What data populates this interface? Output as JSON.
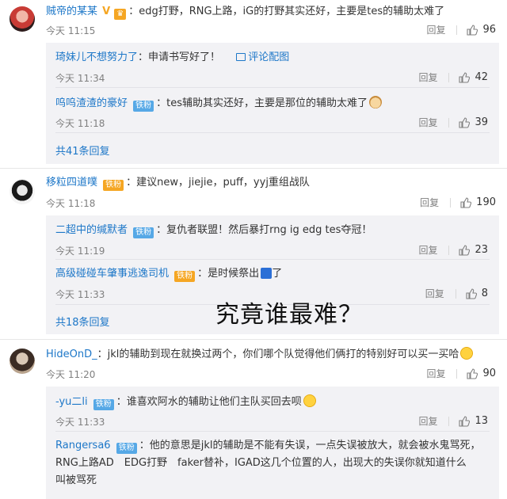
{
  "common": {
    "reply_label": "回复"
  },
  "comments": [
    {
      "username": "贼帝的某某",
      "badge": "V",
      "text": "edg打野，RNG上路，iG的打野其实还好，主要是tes的辅助太难了",
      "time": "今天 11:15",
      "likes": "96",
      "replies": [
        {
          "username": "琦妹儿不想努力了",
          "text": "申请书写好了！",
          "link": "评论配图",
          "time": "今天 11:34",
          "likes": "42"
        },
        {
          "username": "呜呜渣渣的豪好",
          "badge": "铁粉",
          "text": "tes辅助其实还好，主要是那位的辅助太难了",
          "time": "今天 11:18",
          "likes": "39"
        }
      ],
      "more_replies": "共41条回复"
    },
    {
      "username": "移粒四道噗",
      "badge": "铁粉",
      "text": "建议new，jiejie，puff，yyj重组战队",
      "time": "今天 11:18",
      "likes": "190",
      "replies": [
        {
          "username": "二超中的缄默者",
          "badge": "铁粉",
          "text": "复仇者联盟！然后暴打rng ig edg tes夺冠！",
          "time": "今天 11:19",
          "likes": "23"
        },
        {
          "username": "高级碰碰车肇事逃逸司机",
          "badge": "铁粉",
          "text": "是时候祭出",
          "text_after": "了",
          "time": "今天 11:33",
          "likes": "8"
        }
      ],
      "more_replies": "共18条回复"
    },
    {
      "username": "HideOnD_",
      "text": "jkl的辅助到现在就换过两个，你们哪个队觉得他们俩打的特别好可以买一买哈",
      "time": "今天 11:20",
      "likes": "90",
      "replies": [
        {
          "username": "-yu二li",
          "badge": "铁粉",
          "text": "谁喜欢阿水的辅助让他们主队买回去呗",
          "time": "今天 11:33",
          "likes": "13"
        },
        {
          "username": "Rangersa6",
          "badge": "铁粉",
          "text": "他的意思是jkl的辅助是不能有失误，一点失误被放大，就会被水鬼骂死，",
          "text2": "RNG上路AD　EDG打野　faker替补，IGAD这几个位置的人，出现大的失误你就知道什么",
          "text3": "叫被骂死"
        }
      ]
    }
  ],
  "overlay_caption": "究竟谁最难？"
}
